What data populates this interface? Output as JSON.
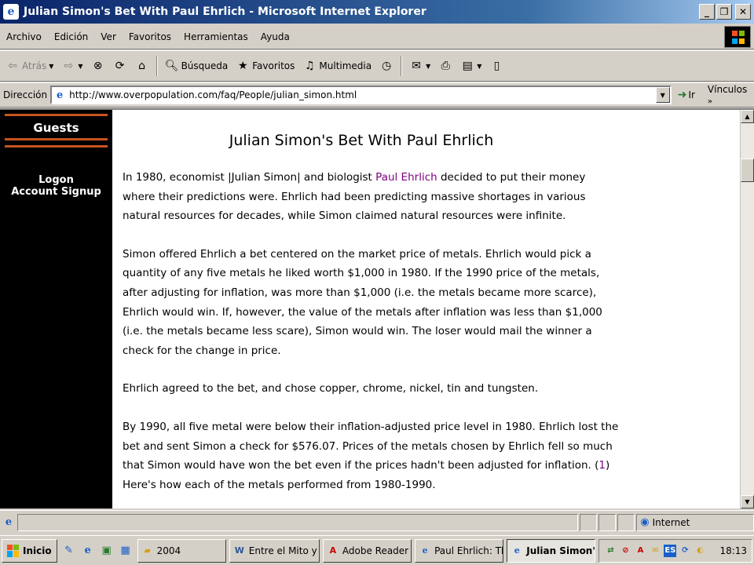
{
  "window": {
    "title": "Julian Simon's Bet With Paul Ehrlich - Microsoft Internet Explorer",
    "minimize": "_",
    "maximize": "❐",
    "close": "✕"
  },
  "menu": {
    "items": [
      "Archivo",
      "Edición",
      "Ver",
      "Favoritos",
      "Herramientas",
      "Ayuda"
    ]
  },
  "toolbar": {
    "back_label": "Atrás",
    "search_label": "Búsqueda",
    "favorites_label": "Favoritos",
    "media_label": "Multimedia"
  },
  "address": {
    "label": "Dirección",
    "url": "http://www.overpopulation.com/faq/People/julian_simon.html",
    "go_label": "Ir",
    "links_label": "Vínculos"
  },
  "sidebar": {
    "heading": "Guests",
    "links": [
      "Logon",
      "Account Signup"
    ]
  },
  "article": {
    "title": "Julian Simon's Bet With Paul Ehrlich",
    "p1_a": "In 1980, economist |Julian Simon| and biologist ",
    "p1_link": "Paul Ehrlich",
    "p1_b": " decided to put their money where their predictions were. Ehrlich had been predicting massive shortages in various natural resources for decades, while Simon claimed natural resources were infinite.",
    "p2": "Simon offered Ehrlich a bet centered on the market price of metals. Ehrlich would pick a quantity of any five metals he liked worth $1,000 in 1980. If the 1990 price of the metals, after adjusting for inflation, was more than $1,000 (i.e. the metals became more scarce), Ehrlich would win. If, however, the value of the metals after inflation was less than $1,000 (i.e. the metals became less scare), Simon would win. The loser would mail the winner a check for the change in price.",
    "p3": "Ehrlich agreed to the bet, and chose copper, chrome, nickel, tin and tungsten.",
    "p4_a": "By 1990, all five metal were below their inflation-adjusted price level in 1980. Ehrlich lost the bet and sent Simon a check for $576.07. Prices of the metals chosen by Ehrlich fell so much that Simon would have won the bet even if the prices hadn't been adjusted for inflation. ",
    "p4_ref_open": "(",
    "p4_ref": "1",
    "p4_ref_close": ")",
    "p4_b": " Here's how each of the metals performed from 1980-1990."
  },
  "status": {
    "zone": "Internet"
  },
  "taskbar": {
    "start_label": "Inicio",
    "buttons": [
      {
        "label": "2004"
      },
      {
        "label": "Entre el Mito y la R..."
      },
      {
        "label": "Adobe Reader - [Bi..."
      },
      {
        "label": "Paul Ehrlich: The E..."
      },
      {
        "label": "Julian Simon's B..."
      }
    ],
    "tray_lang": "ES",
    "clock": "18:13"
  },
  "colors": {
    "title_gradient_start": "#0a246a",
    "sidebar_bg": "#000000",
    "sidebar_rule": "#c8531f",
    "visited_link": "#800080",
    "chrome": "#d4d0c8"
  }
}
